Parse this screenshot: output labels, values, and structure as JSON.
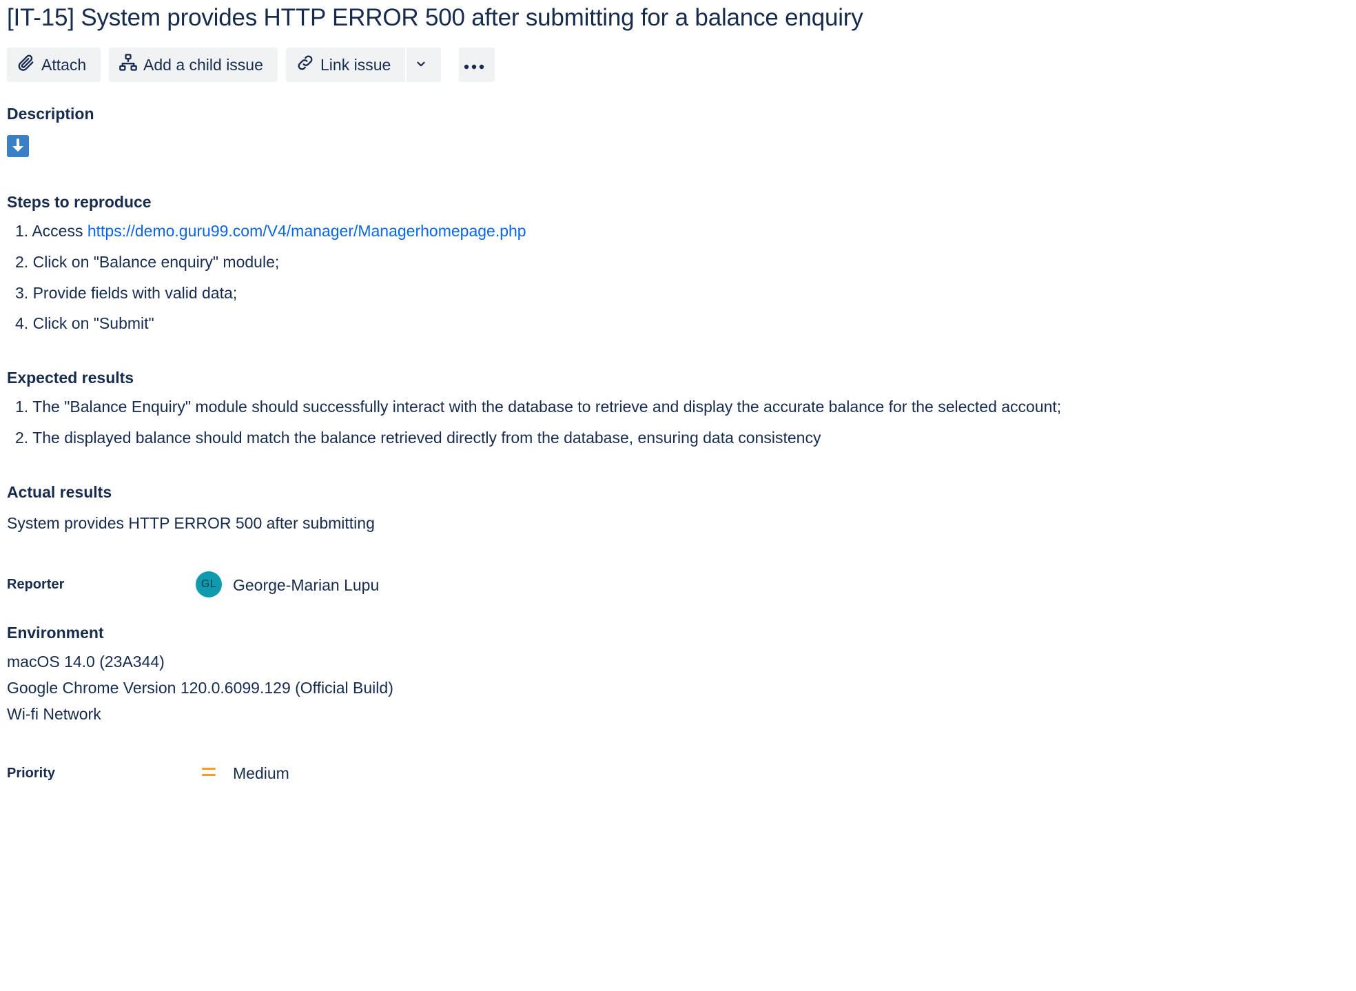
{
  "issue": {
    "title": "[IT-15] System provides HTTP ERROR 500 after submitting for a balance enquiry"
  },
  "toolbar": {
    "attach_label": "Attach",
    "add_child_label": "Add a child issue",
    "link_issue_label": "Link issue"
  },
  "description": {
    "heading": "Description",
    "steps_heading": "Steps to reproduce",
    "steps": [
      {
        "num": "1.",
        "prefix": "Access ",
        "link": "https://demo.guru99.com/V4/manager/Managerhomepage.php"
      },
      {
        "num": "2.",
        "text": "Click on \"Balance enquiry\" module;"
      },
      {
        "num": "3.",
        "text": "Provide fields with valid data;"
      },
      {
        "num": "4.",
        "text": "Click on \"Submit\""
      }
    ],
    "expected_heading": "Expected results",
    "expected": [
      {
        "num": "1.",
        "text": "The \"Balance Enquiry\" module should successfully interact with the database to retrieve and display the accurate balance for the selected account;"
      },
      {
        "num": "2.",
        "text": "The displayed balance should match the balance retrieved directly from the database, ensuring data consistency"
      }
    ],
    "actual_heading": "Actual results",
    "actual_text": "System provides HTTP ERROR 500 after submitting"
  },
  "reporter": {
    "label": "Reporter",
    "initials": "GL",
    "name": "George-Marian Lupu",
    "avatar_color": "#0e9aaf"
  },
  "environment": {
    "heading": "Environment",
    "lines": [
      "macOS 14.0 (23A344)",
      "Google Chrome Version 120.0.6099.129 (Official Build)",
      "Wi-fi Network"
    ]
  },
  "priority": {
    "label": "Priority",
    "value": "Medium",
    "icon_color": "#ff991f"
  },
  "colors": {
    "text": "#172b4d",
    "link": "#0c66e4",
    "button_bg": "#f1f2f4",
    "description_icon": "#3b7fc4"
  }
}
